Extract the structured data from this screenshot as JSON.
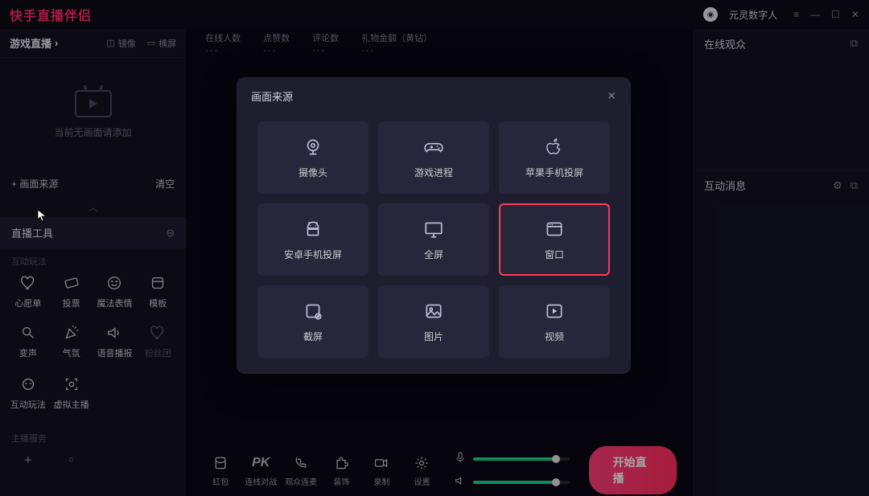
{
  "app_title": "快手直播伴侣",
  "user": {
    "name": "元灵数字人"
  },
  "sidebar": {
    "mode_label": "游戏直播",
    "mirror_label": "镜像",
    "landscape_label": "横屏",
    "empty_hint": "当前无画面请添加",
    "add_source_label": "+ 画面来源",
    "clear_label": "清空",
    "tools_title": "直播工具",
    "section_interactive": "互动玩法",
    "section_host": "主播服务",
    "tools": [
      {
        "label": "心愿单"
      },
      {
        "label": "投票"
      },
      {
        "label": "魔法表情"
      },
      {
        "label": "模板"
      },
      {
        "label": "变声"
      },
      {
        "label": "气氛"
      },
      {
        "label": "语音播报"
      },
      {
        "label": "粉丝团"
      },
      {
        "label": "互动玩法"
      },
      {
        "label": "虚拟主播"
      }
    ]
  },
  "stats": [
    {
      "label": "在线人数",
      "value": "---"
    },
    {
      "label": "点赞数",
      "value": "---"
    },
    {
      "label": "评论数",
      "value": "---"
    },
    {
      "label": "礼物金额（黄钻）",
      "value": "---"
    }
  ],
  "bottombar": [
    {
      "label": "红包"
    },
    {
      "label": "连线对战"
    },
    {
      "label": "观众连麦"
    },
    {
      "label": "装饰"
    },
    {
      "label": "录制"
    },
    {
      "label": "设置"
    }
  ],
  "start_btn": "开始直播",
  "right": {
    "viewers_title": "在线观众",
    "messages_title": "互动消息"
  },
  "modal": {
    "title": "画面来源",
    "sources": [
      {
        "label": "摄像头"
      },
      {
        "label": "游戏进程"
      },
      {
        "label": "苹果手机投屏"
      },
      {
        "label": "安卓手机投屏"
      },
      {
        "label": "全屏"
      },
      {
        "label": "窗口",
        "selected": true
      },
      {
        "label": "截屏"
      },
      {
        "label": "图片"
      },
      {
        "label": "视频"
      }
    ]
  }
}
